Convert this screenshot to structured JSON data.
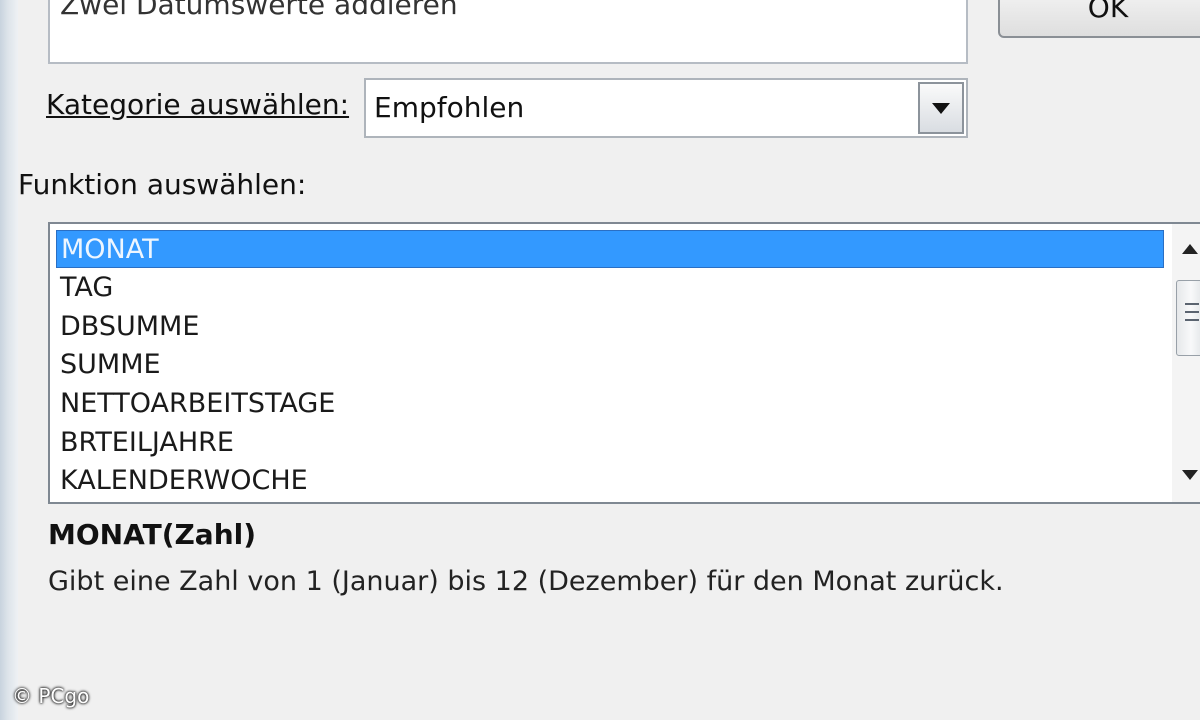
{
  "search": {
    "text": "Zwei Datumswerte addieren"
  },
  "buttons": {
    "ok": "OK"
  },
  "category": {
    "label": "Kategorie auswählen:",
    "selected": "Empfohlen"
  },
  "function_list": {
    "label": "Funktion auswählen:",
    "items": [
      "MONAT",
      "TAG",
      "DBSUMME",
      "SUMME",
      "NETTOARBEITSTAGE",
      "BRTEILJAHRE",
      "KALENDERWOCHE"
    ],
    "selected_index": 0
  },
  "function_detail": {
    "signature": "MONAT(Zahl)",
    "description": "Gibt eine Zahl von 1 (Januar) bis 12 (Dezember) für den Monat zurück."
  },
  "watermark": "© PCgo",
  "colors": {
    "selection": "#3399ff",
    "window_bg": "#f0f0f0"
  }
}
